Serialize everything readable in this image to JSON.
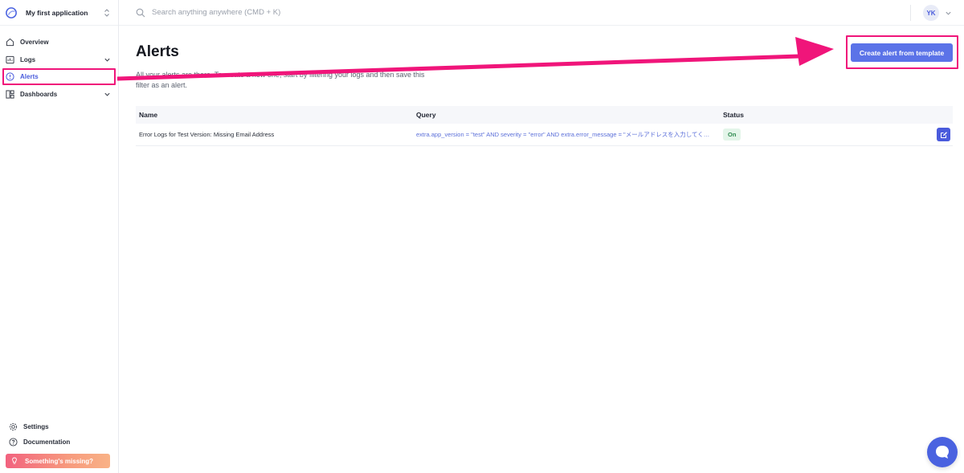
{
  "app": {
    "name": "My first application"
  },
  "sidebar": {
    "items": [
      {
        "label": "Overview",
        "icon": "home-icon"
      },
      {
        "label": "Logs",
        "icon": "logs-icon"
      },
      {
        "label": "Alerts",
        "icon": "alert-circle-icon",
        "active": true
      },
      {
        "label": "Dashboards",
        "icon": "dashboard-icon"
      }
    ],
    "bottom": {
      "settings": "Settings",
      "documentation": "Documentation",
      "missing": "Something's missing?"
    }
  },
  "search": {
    "placeholder": "Search anything anywhere (CMD + K)"
  },
  "user": {
    "initials": "YK"
  },
  "page": {
    "title": "Alerts",
    "description": "All your alerts are there. To create a new one, start by filtering your logs and then save this filter as an alert.",
    "create_button": "Create alert from template"
  },
  "table": {
    "columns": {
      "name": "Name",
      "query": "Query",
      "status": "Status"
    },
    "rows": [
      {
        "name": "Error Logs for Test Version: Missing Email Address",
        "query": "extra.app_version = \"test\" AND severity = \"error\" AND extra.error_message = \"メールアドレスを入力してください\"",
        "status": "On"
      }
    ]
  },
  "colors": {
    "accent": "#5b73e8",
    "highlight": "#f0157a",
    "status_on_bg": "#e3f5e9",
    "status_on_text": "#2d8a4e"
  }
}
